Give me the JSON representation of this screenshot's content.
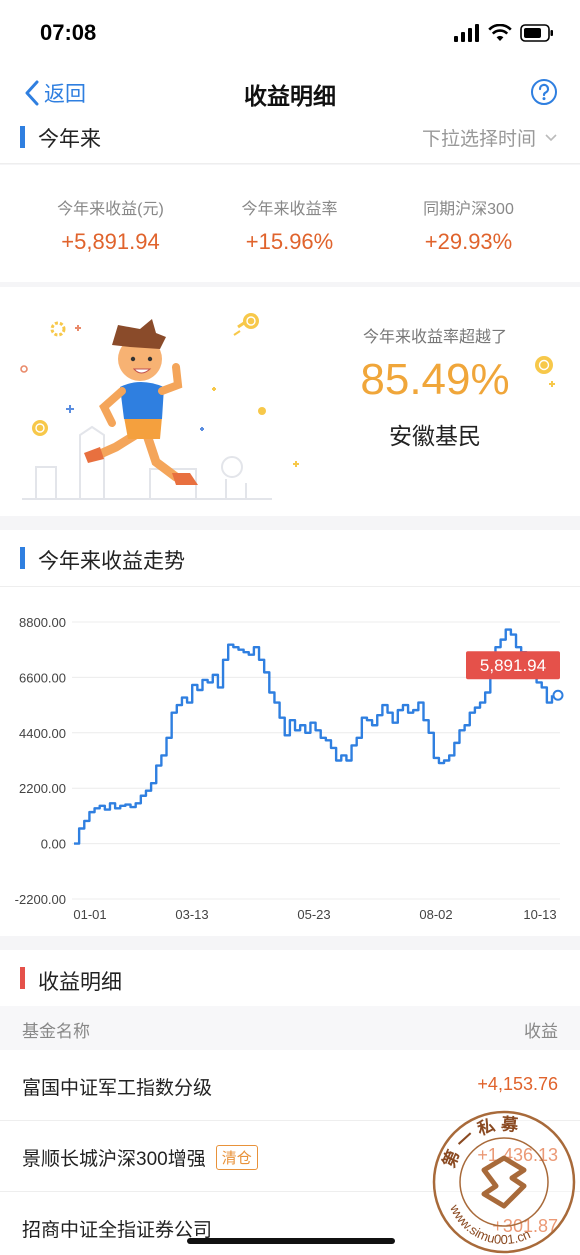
{
  "status": {
    "time": "07:08"
  },
  "nav": {
    "back_label": "返回",
    "title": "收益明细"
  },
  "period": {
    "title": "今年来",
    "picker_label": "下拉选择时间"
  },
  "stats": [
    {
      "label": "今年来收益(元)",
      "value": "+5,891.94"
    },
    {
      "label": "今年来收益率",
      "value": "+15.96%"
    },
    {
      "label": "同期沪深300",
      "value": "+29.93%"
    }
  ],
  "ranking": {
    "caption": "今年来收益率超越了",
    "value": "85.49%",
    "region": "安徽基民"
  },
  "trend": {
    "title": "今年来收益走势",
    "current_label": "5,891.94"
  },
  "chart_data": {
    "type": "line",
    "title": "今年来收益走势",
    "xlabel": "",
    "ylabel": "",
    "ylim": [
      -2200,
      8800
    ],
    "y_ticks": [
      "8800.00",
      "6600.00",
      "4400.00",
      "2200.00",
      "0.00",
      "-2200.00"
    ],
    "x_ticks": [
      "01-01",
      "03-13",
      "05-23",
      "08-02",
      "10-13"
    ],
    "grid": true,
    "line_color": "#2f7fe0",
    "series": [
      {
        "values": [
          0,
          600,
          900,
          1250,
          1400,
          1500,
          1350,
          1600,
          1400,
          1500,
          1550,
          1450,
          1600,
          1900,
          2100,
          2400,
          3100,
          3500,
          4200,
          5200,
          5500,
          5800,
          5600,
          6300,
          6100,
          6500,
          6400,
          6700,
          6200,
          7300,
          7900,
          7800,
          7700,
          7600,
          7500,
          7800,
          7300,
          6800,
          6000,
          5600,
          5000,
          4300,
          4900,
          4500,
          4700,
          4400,
          4800,
          4500,
          4200,
          4100,
          3800,
          3300,
          3500,
          3300,
          3900,
          4200,
          5000,
          4900,
          4700,
          5100,
          5500,
          5200,
          4800,
          5300,
          5500,
          5200,
          5300,
          5600,
          4900,
          4400,
          3400,
          3200,
          3300,
          3500,
          4000,
          4500,
          4700,
          5200,
          5400,
          5600,
          6000,
          7000,
          7800,
          8100,
          8500,
          8300,
          7800,
          7600,
          7300,
          6600,
          6400,
          6200,
          5600,
          5891.94
        ],
        "line_label": "5,891.94"
      }
    ]
  },
  "detail": {
    "title": "收益明细",
    "col_name": "基金名称",
    "col_gain": "收益",
    "rows": [
      {
        "name": "富国中证军工指数分级",
        "tag": "",
        "gain": "+4,153.76"
      },
      {
        "name": "景顺长城沪深300增强",
        "tag": "清仓",
        "gain": "+1,436.13"
      },
      {
        "name": "招商中证全指证券公司",
        "tag": "",
        "gain": "+301.87"
      }
    ]
  },
  "watermark": {
    "top_text": "第 一 私 募",
    "bottom_text": "www.simu001.cn"
  },
  "colors": {
    "accent_blue": "#2f7fe0",
    "gain_orange": "#e0632c",
    "rank_gold": "#f0a63a",
    "tooltip_red": "#e5514a",
    "detail_mark_red": "#e5514a"
  }
}
